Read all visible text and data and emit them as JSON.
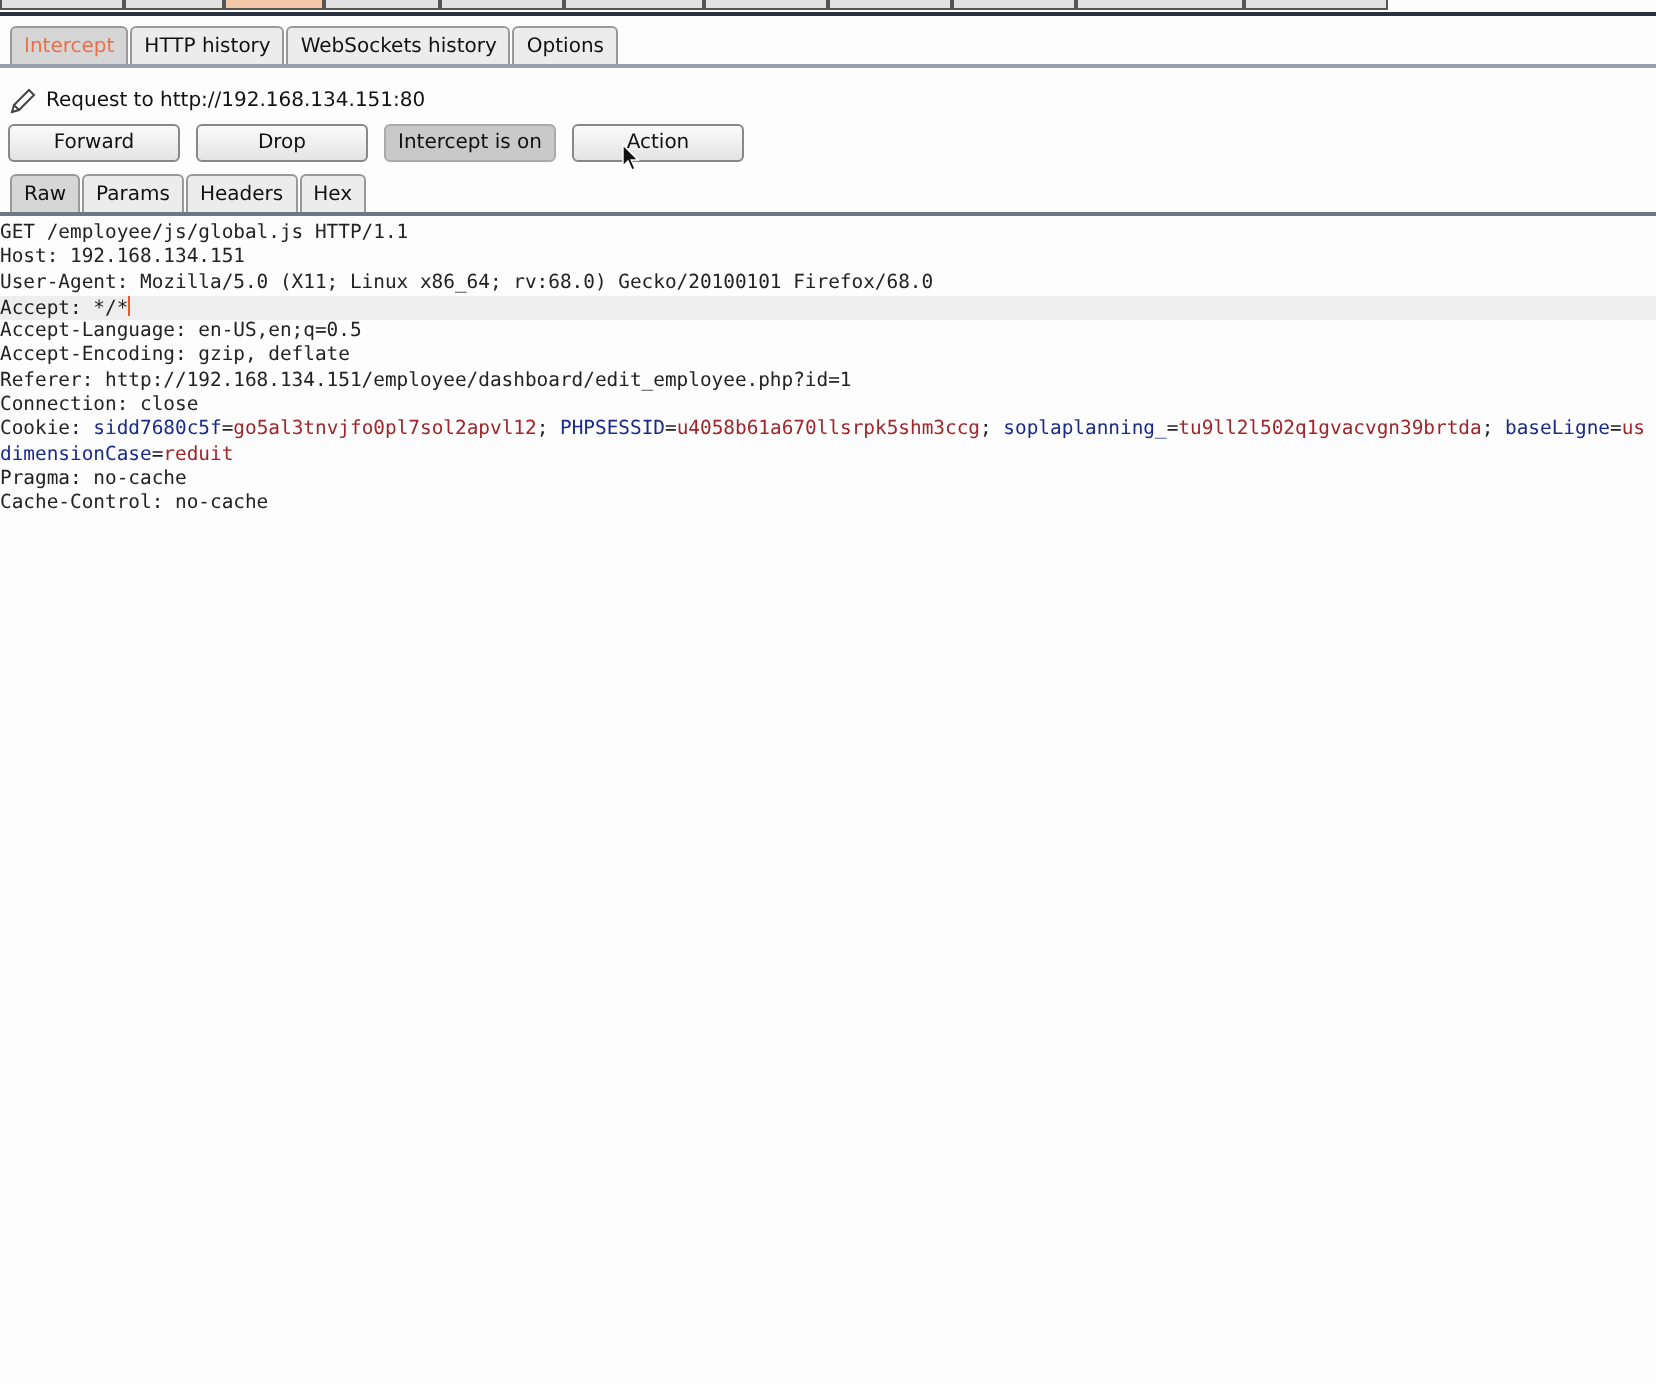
{
  "main_tabs": [
    {
      "selected": false
    },
    {
      "selected": false
    },
    {
      "selected": true
    },
    {
      "selected": false
    },
    {
      "selected": false
    },
    {
      "selected": false
    },
    {
      "selected": false
    },
    {
      "selected": false
    },
    {
      "selected": false
    },
    {
      "selected": false
    },
    {
      "selected": false
    }
  ],
  "proxy_tabs": [
    {
      "label": "Intercept",
      "selected": true
    },
    {
      "label": "HTTP history",
      "selected": false
    },
    {
      "label": "WebSockets history",
      "selected": false
    },
    {
      "label": "Options",
      "selected": false
    }
  ],
  "request_info": "Request to http://192.168.134.151:80",
  "buttons": [
    {
      "label": "Forward",
      "pressed": false
    },
    {
      "label": "Drop",
      "pressed": false
    },
    {
      "label": "Intercept is on",
      "pressed": true
    },
    {
      "label": "Action",
      "pressed": false
    }
  ],
  "view_tabs": [
    {
      "label": "Raw",
      "selected": true
    },
    {
      "label": "Params",
      "selected": false
    },
    {
      "label": "Headers",
      "selected": false
    },
    {
      "label": "Hex",
      "selected": false
    }
  ],
  "request_lines": [
    {
      "current": false,
      "segments": [
        {
          "kind": "plain",
          "text": "GET /employee/js/global.js HTTP/1.1"
        }
      ]
    },
    {
      "current": false,
      "segments": [
        {
          "kind": "plain",
          "text": "Host: 192.168.134.151"
        }
      ]
    },
    {
      "current": false,
      "segments": [
        {
          "kind": "plain",
          "text": "User-Agent: Mozilla/5.0 (X11; Linux x86_64; rv:68.0) Gecko/20100101 Firefox/68.0"
        }
      ]
    },
    {
      "current": true,
      "segments": [
        {
          "kind": "plain",
          "text": "Accept: */*"
        }
      ]
    },
    {
      "current": false,
      "segments": [
        {
          "kind": "plain",
          "text": "Accept-Language: en-US,en;q=0.5"
        }
      ]
    },
    {
      "current": false,
      "segments": [
        {
          "kind": "plain",
          "text": "Accept-Encoding: gzip, deflate"
        }
      ]
    },
    {
      "current": false,
      "segments": [
        {
          "kind": "plain",
          "text": "Referer: http://192.168.134.151/employee/dashboard/edit_employee.php?id=1"
        }
      ]
    },
    {
      "current": false,
      "segments": [
        {
          "kind": "plain",
          "text": "Connection: close"
        }
      ]
    },
    {
      "current": false,
      "segments": [
        {
          "kind": "plain",
          "text": "Cookie: "
        },
        {
          "kind": "name",
          "text": "sidd7680c5f"
        },
        {
          "kind": "plain",
          "text": "="
        },
        {
          "kind": "value",
          "text": "go5al3tnvjfo0pl7sol2apvl12"
        },
        {
          "kind": "plain",
          "text": "; "
        },
        {
          "kind": "name",
          "text": "PHPSESSID"
        },
        {
          "kind": "plain",
          "text": "="
        },
        {
          "kind": "value",
          "text": "u4058b61a670llsrpk5shm3ccg"
        },
        {
          "kind": "plain",
          "text": "; "
        },
        {
          "kind": "name",
          "text": "soplaplanning_"
        },
        {
          "kind": "plain",
          "text": "="
        },
        {
          "kind": "value",
          "text": "tu9ll2l502q1gvacvgn39brtda"
        },
        {
          "kind": "plain",
          "text": "; "
        },
        {
          "kind": "name",
          "text": "baseLigne"
        },
        {
          "kind": "plain",
          "text": "="
        },
        {
          "kind": "value",
          "text": "us"
        }
      ]
    },
    {
      "current": false,
      "segments": [
        {
          "kind": "name",
          "text": "dimensionCase"
        },
        {
          "kind": "plain",
          "text": "="
        },
        {
          "kind": "value",
          "text": "reduit"
        }
      ]
    },
    {
      "current": false,
      "segments": [
        {
          "kind": "plain",
          "text": "Pragma: no-cache"
        }
      ]
    },
    {
      "current": false,
      "segments": [
        {
          "kind": "plain",
          "text": "Cache-Control: no-cache"
        }
      ]
    }
  ]
}
